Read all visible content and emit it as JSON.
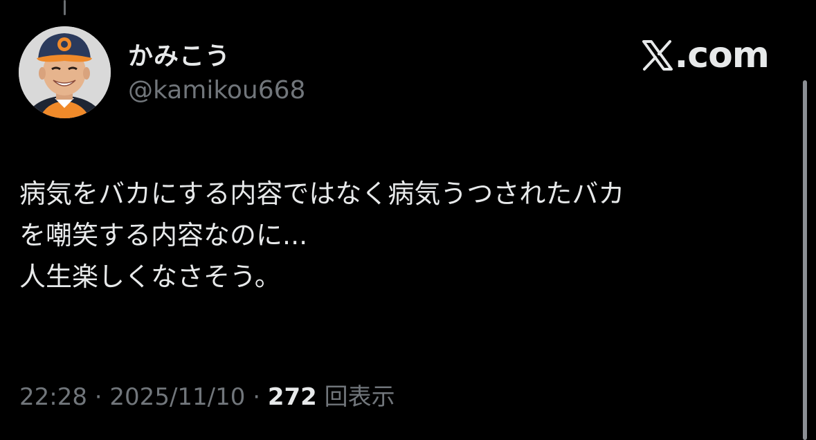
{
  "author": {
    "display_name": "かみこう",
    "handle": "@kamikou668",
    "avatar_icon": "avatar-photo"
  },
  "brand": {
    "label": ".com",
    "icon": "x-logo-icon"
  },
  "tweet": {
    "lines": [
      "病気をバカにする内容ではなく病気うつされたバカ",
      "を嘲笑する内容なのに...",
      "人生楽しくなさそう。"
    ]
  },
  "meta": {
    "time": "22:28",
    "separator1": " · ",
    "date": "2025/11/10",
    "separator2": " · ",
    "views_count": "272",
    "views_label": "回表示"
  },
  "colors": {
    "background": "#000000",
    "primary_text": "#e7e9ea",
    "secondary_text": "#71767b",
    "cap_orange": "#f08a2a",
    "cap_navy": "#2b3a5c"
  }
}
